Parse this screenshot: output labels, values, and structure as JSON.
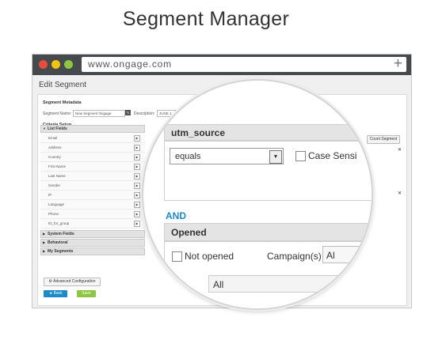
{
  "headline": "Segment Manager",
  "browser": {
    "url": "www.ongage.com",
    "new_tab": "+",
    "dots": [
      "#e74c3c",
      "#f1c40f",
      "#8dc63f"
    ]
  },
  "app": {
    "title": "Edit Segment",
    "metadata_heading": "Segment Metadata",
    "segment_name_label": "Segment Name:",
    "segment_name_value": "New Segment Ongage",
    "description_label": "Description:",
    "description_value": "JUNE 1",
    "criteria_heading": "Criteria Setup",
    "count_button": "Count Segment",
    "list_fields_heading": "List Fields",
    "list_fields": [
      "Email",
      "Address",
      "Country",
      "First Name",
      "Last Name",
      "Gender",
      "IP",
      "Language",
      "Phone",
      "ID_for_group"
    ],
    "system_fields": "System Fields",
    "behavioral": "Behavioral",
    "my_segments": "My Segments",
    "advanced_button": "Advanced Configuration",
    "back_button": "◄ Back",
    "save_button": "Save"
  },
  "zoom": {
    "field_title": "utm_source",
    "operator": "equals",
    "case_label": "Case Sensi",
    "and_label": "AND",
    "opened_title": "Opened",
    "not_opened_label": "Not opened",
    "campaigns_label": "Campaign(s)",
    "campaigns_value": "Al",
    "all_label": "All"
  },
  "colors": {
    "accent_blue": "#1a8ac9",
    "save_green": "#8dc63f",
    "chrome": "#474a4c"
  }
}
